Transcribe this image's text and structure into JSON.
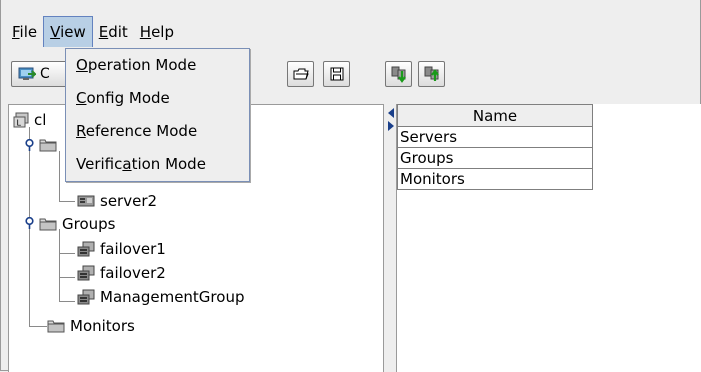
{
  "menubar": {
    "items": [
      {
        "pre": "",
        "ul": "F",
        "post": "ile"
      },
      {
        "pre": "",
        "ul": "V",
        "post": "iew"
      },
      {
        "pre": "",
        "ul": "E",
        "post": "dit"
      },
      {
        "pre": "",
        "ul": "H",
        "post": "elp"
      }
    ]
  },
  "view_menu": {
    "items": [
      {
        "pre": "",
        "ul": "O",
        "post": "peration Mode"
      },
      {
        "pre": "",
        "ul": "C",
        "post": "onfig Mode"
      },
      {
        "pre": "",
        "ul": "R",
        "post": "eference Mode"
      },
      {
        "pre": "Verific",
        "ul": "a",
        "post": "tion Mode"
      }
    ]
  },
  "toolbar": {
    "mode_label_partial": "C"
  },
  "tree": {
    "root_label_partial": "cl",
    "server2": "server2",
    "groups": "Groups",
    "failover1": "failover1",
    "failover2": "failover2",
    "management_group": "ManagementGroup",
    "monitors": "Monitors"
  },
  "table": {
    "header": "Name",
    "rows": [
      "Servers",
      "Groups",
      "Monitors"
    ]
  },
  "colors": {
    "menu_highlight": "#b8cfe5",
    "background": "#eeeeee"
  }
}
